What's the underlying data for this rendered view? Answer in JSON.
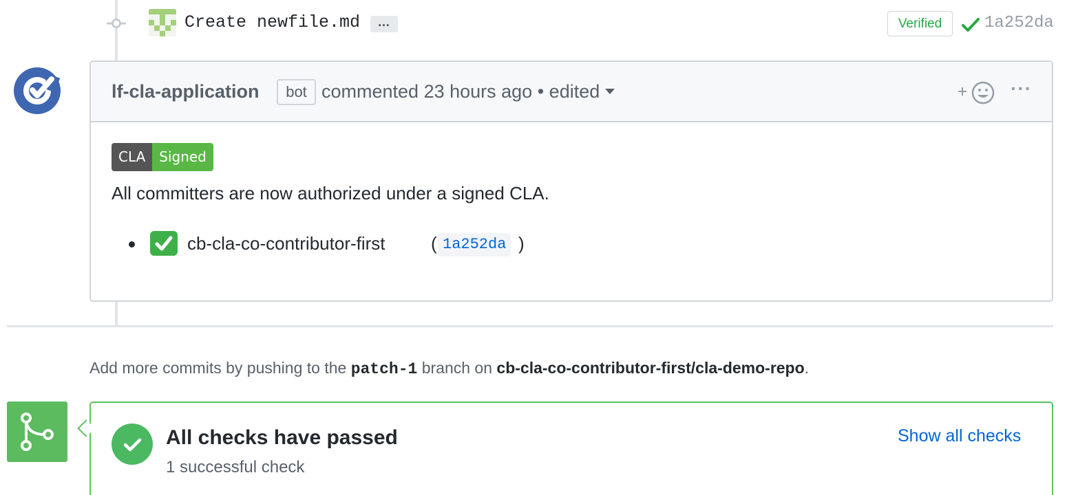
{
  "commit": {
    "message": "Create newfile.md",
    "ellipsis": "…",
    "verified_label": "Verified",
    "sha": "1a252da"
  },
  "comment": {
    "author": "lf-cla-application",
    "bot_label": "bot",
    "meta": "commented 23 hours ago •",
    "edited": "edited",
    "reaction_plus": "+",
    "kebab": "···",
    "badge_left": "CLA",
    "badge_right": "Signed",
    "body": "All committers are now authorized under a signed CLA.",
    "committer_name": "cb-cla-co-contributor-first",
    "paren_open": "(",
    "committer_sha": "1a252da",
    "paren_close": ")"
  },
  "push_note": {
    "prefix": "Add more commits by pushing to the",
    "branch": "patch-1",
    "middle": "branch on",
    "repo": "cb-cla-co-contributor-first/cla-demo-repo",
    "suffix": "."
  },
  "checks": {
    "title": "All checks have passed",
    "subtitle": "1 successful check",
    "show_all": "Show all checks"
  },
  "colors": {
    "success": "#28a745",
    "link": "#0366d6",
    "bot_avatar": "#3f67b1"
  }
}
